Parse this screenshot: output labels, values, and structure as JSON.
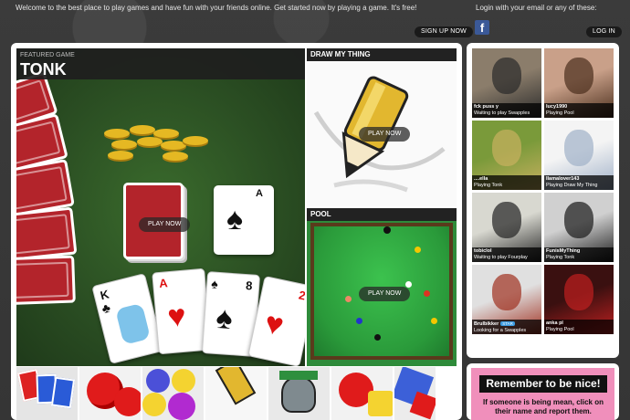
{
  "header": {
    "welcome": "Welcome to the best place to play games and have fun with your friends online. Get started now by playing a game. It's free!",
    "signup_label": "SIGN UP NOW",
    "login_prompt": "Login with your email or any of these:",
    "login_label": "LOG IN",
    "facebook_icon": "facebook-icon"
  },
  "featured": {
    "label": "FEATURED GAME",
    "title": "TONK",
    "play_label": "PLAY NOW"
  },
  "side_games": [
    {
      "title": "DRAW MY THING",
      "play_label": "PLAY NOW"
    },
    {
      "title": "POOL",
      "play_label": "PLAY NOW"
    }
  ],
  "card_values": [
    "K",
    "A",
    "8",
    "2",
    "A"
  ],
  "users": [
    {
      "name": "fck puss y",
      "status": "Waiting to play Swapples",
      "colors": [
        "#8b7d6b",
        "#2a2a2a"
      ]
    },
    {
      "name": "lucy1990",
      "status": "Playing Pool",
      "colors": [
        "#c9a089",
        "#4a2e1c"
      ]
    },
    {
      "name": "....ella",
      "status": "Playing Tonk",
      "colors": [
        "#7a9a3a",
        "#c9b060"
      ]
    },
    {
      "name": "llamalover143",
      "status": "Playing Draw My Thing",
      "colors": [
        "#f4f4f4",
        "#9fb0c8"
      ]
    },
    {
      "name": "tobiclol",
      "status": "Waiting to play Fourplay",
      "colors": [
        "#d8d8d0",
        "#222"
      ]
    },
    {
      "name": "FunisMyThing",
      "status": "Playing Tonk",
      "colors": [
        "#d0d0d0",
        "#1a1a1a"
      ]
    },
    {
      "name": "Brulbikker",
      "badge": "STAR",
      "status": "Looking for a Swapples match",
      "colors": [
        "#e0e0e0",
        "#a03020"
      ]
    },
    {
      "name": "anka pl",
      "status": "Playing Pool",
      "colors": [
        "#3a1010",
        "#c02020"
      ]
    }
  ],
  "remember": {
    "title": "Remember to be nice!",
    "body": "If someone is being mean, click on their name and report them."
  }
}
